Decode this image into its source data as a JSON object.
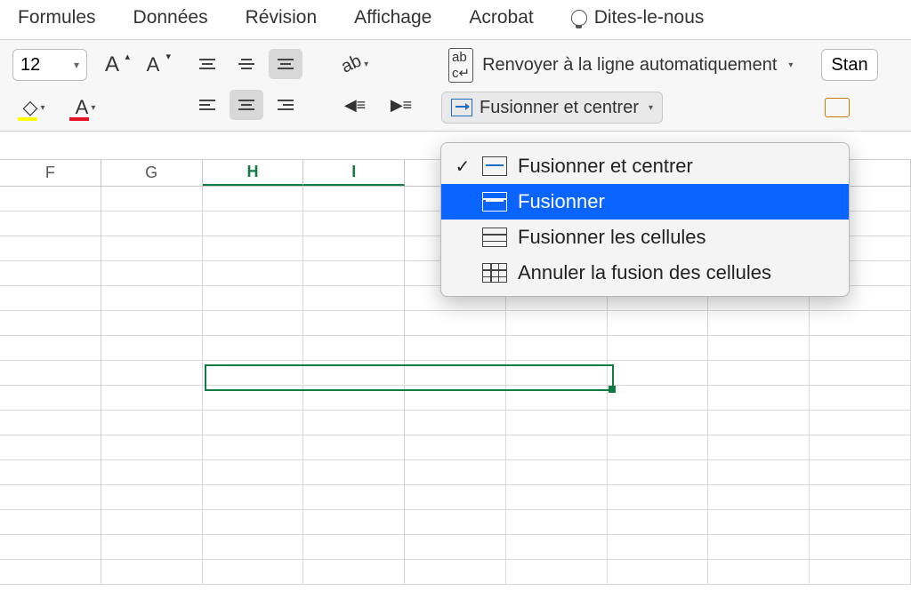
{
  "menubar": {
    "formulas": "Formules",
    "data": "Données",
    "review": "Révision",
    "view": "Affichage",
    "acrobat": "Acrobat",
    "tell_me": "Dites-le-nous"
  },
  "ribbon": {
    "font_size": "12",
    "wrap_text": "Renvoyer à la ligne automatiquement",
    "merge_center": "Fusionner et centrer",
    "number_format": "Stan"
  },
  "dropdown": {
    "merge_and_center": "Fusionner et centrer",
    "merge_across": "Fusionner",
    "merge_cells": "Fusionner les cellules",
    "unmerge": "Annuler la fusion des cellules"
  },
  "columns": [
    "F",
    "G",
    "H",
    "I",
    "",
    "",
    "",
    "",
    ""
  ],
  "active_columns": [
    "H",
    "I"
  ]
}
